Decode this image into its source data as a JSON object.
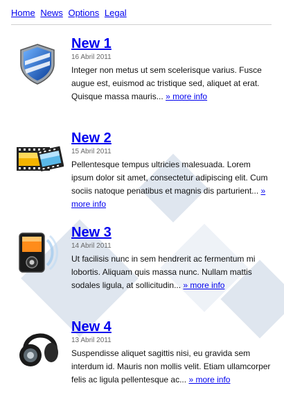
{
  "nav": {
    "items": [
      "Home",
      "News",
      "Options",
      "Legal"
    ]
  },
  "news": [
    {
      "icon": "shield-icon",
      "title": "New 1",
      "date": "16 Abril 2011",
      "text": "Integer non metus ut sem scelerisque varius. Fusce augue est, euismod ac tristique sed, aliquet at erat. Quisque massa mauris... ",
      "more": "» more info"
    },
    {
      "icon": "film-icon",
      "title": "New 2",
      "date": "15 Abril 2011",
      "text": "Pellentesque tempus ultricies malesuada. Lorem ipsum dolor sit amet, consectetur adipiscing elit. Cum sociis natoque penatibus et magnis dis parturient... ",
      "more": "» more info"
    },
    {
      "icon": "media-player-icon",
      "title": "New 3",
      "date": "14 Abril 2011",
      "text": "Ut facilisis nunc in sem hendrerit ac fermentum mi lobortis. Aliquam quis massa nunc. Nullam mattis sodales ligula, at sollicitudin... ",
      "more": "» more info"
    },
    {
      "icon": "headphones-icon",
      "title": "New 4",
      "date": "13 Abril 2011",
      "text": "Suspendisse aliquet sagittis nisi, eu gravida sem interdum id. Mauris non mollis velit. Etiam ullamcorper felis ac ligula pellentesque ac... ",
      "more": "» more info"
    }
  ]
}
